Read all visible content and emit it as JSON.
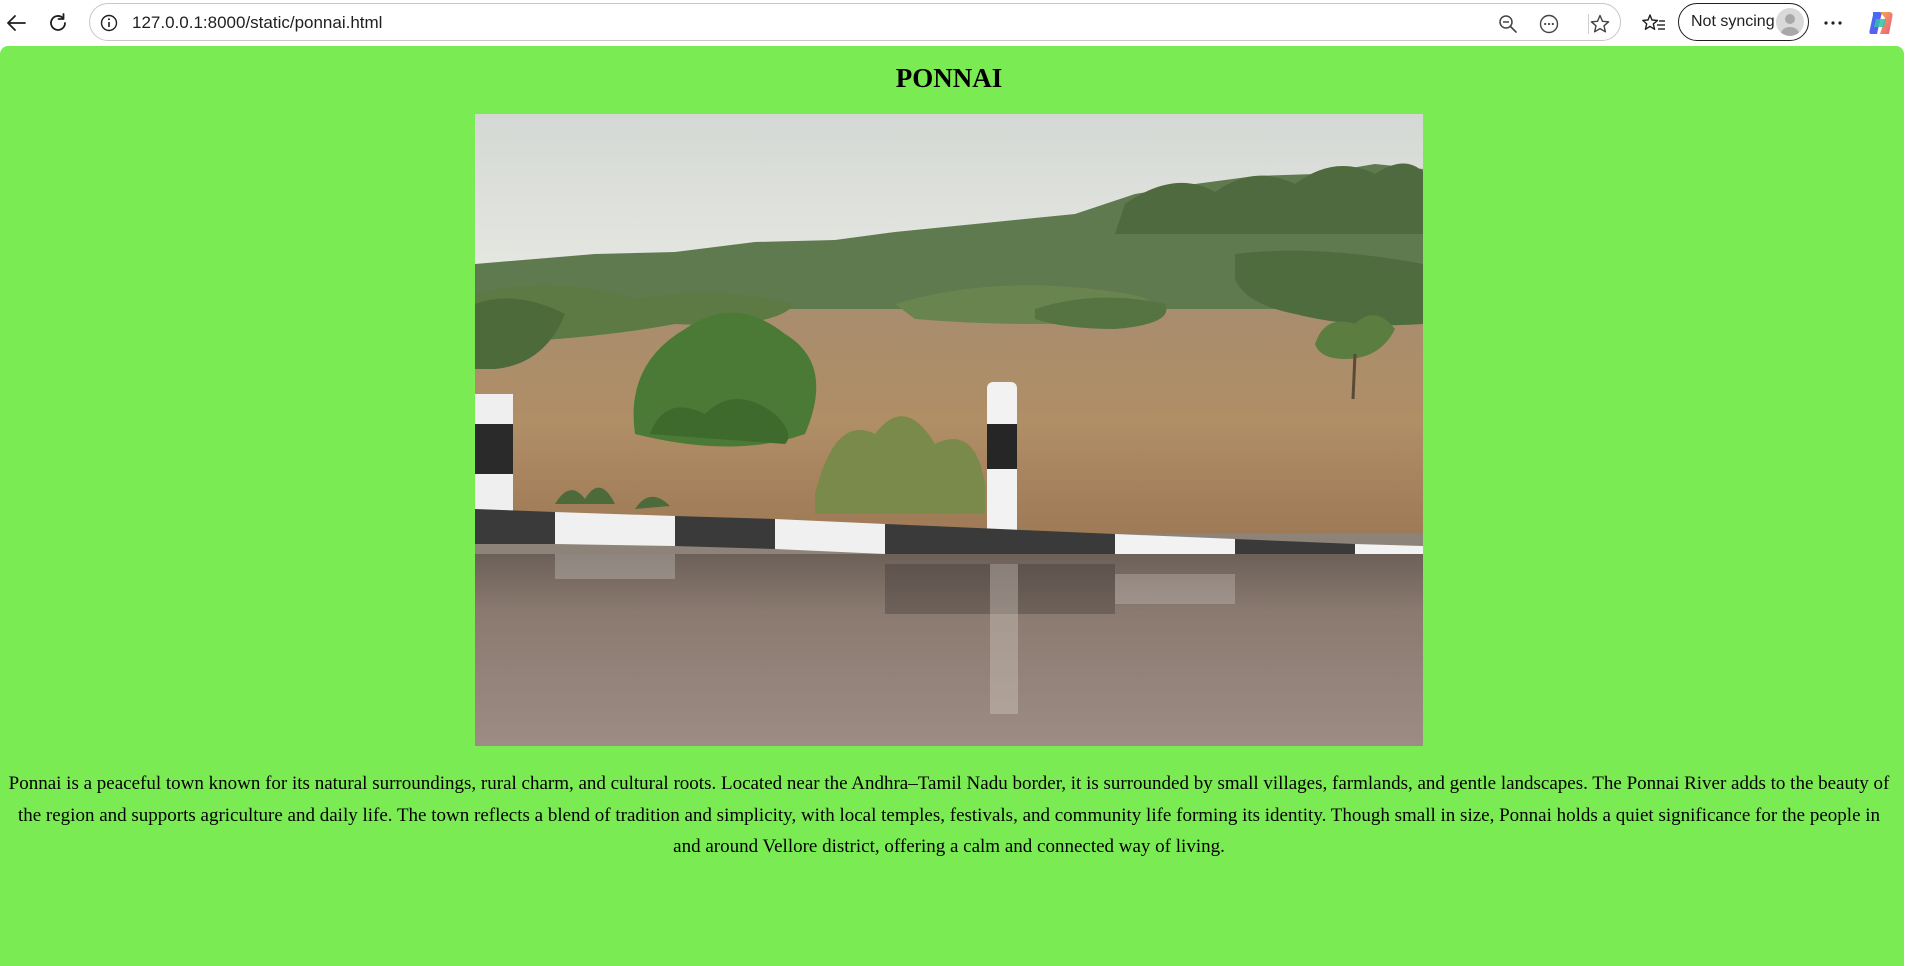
{
  "browser": {
    "url": "127.0.0.1:8000/static/ponnai.html",
    "profile_label": "Not syncing",
    "icons": {
      "back": "back-arrow-icon",
      "refresh": "refresh-icon",
      "site_info": "info-icon",
      "zoom": "zoom-out-icon",
      "read_aloud": "more-circle-icon",
      "favorite": "star-icon",
      "favorites_list": "favorites-icon",
      "menu": "ellipsis-icon",
      "copilot": "copilot-icon"
    }
  },
  "page": {
    "title": "PONNAI",
    "background_color": "#7beb54",
    "image_subject": "flooded river",
    "description": "Ponnai is a peaceful town known for its natural surroundings, rural charm, and cultural roots. Located near the Andhra–Tamil Nadu border, it is surrounded by small villages, farmlands, and gentle landscapes. The Ponnai River adds to the beauty of the region and supports agriculture and daily life. The town reflects a blend of tradition and simplicity, with local temples, festivals, and community life forming its identity. Though small in size, Ponnai holds a quiet significance for the people in and around Vellore district, offering a calm and connected way of living."
  }
}
